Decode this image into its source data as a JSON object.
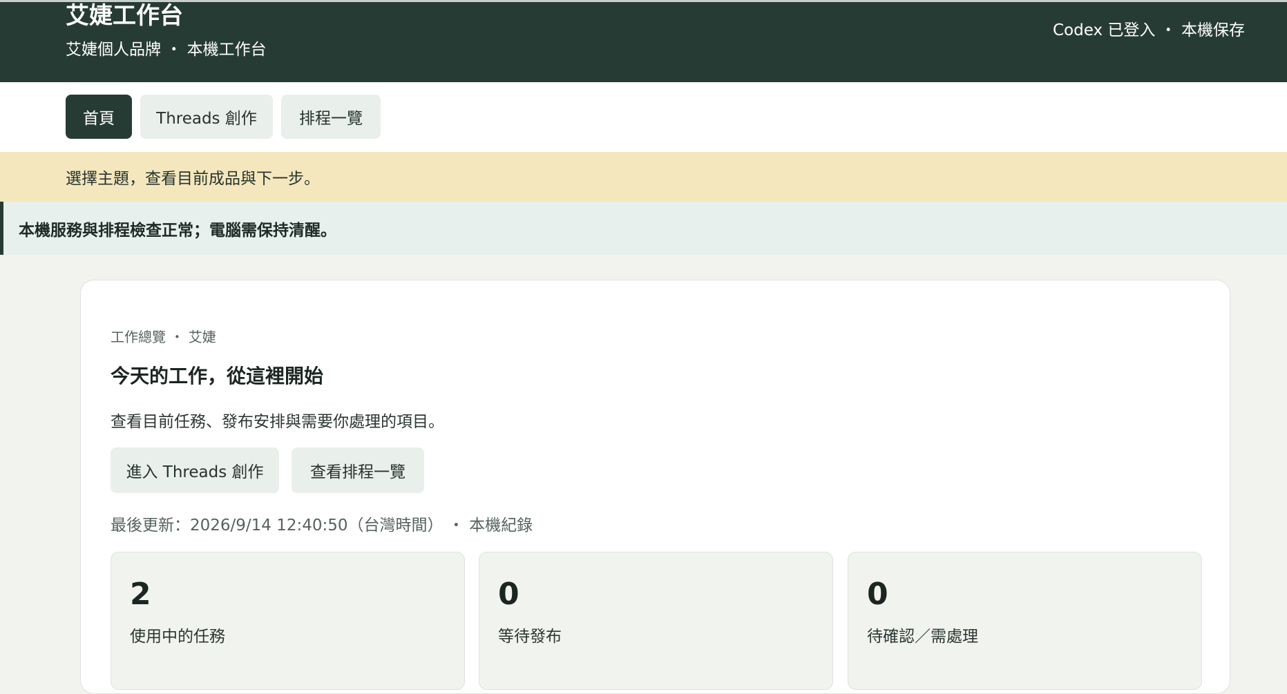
{
  "header": {
    "title": "艾婕工作台",
    "subtitle": "艾婕個人品牌 ・ 本機工作台",
    "session_status": "Codex 已登入 ・ 本機保存"
  },
  "tabs": [
    {
      "label": "首頁",
      "active": true
    },
    {
      "label": "Threads 創作",
      "active": false
    },
    {
      "label": "排程一覽",
      "active": false
    }
  ],
  "hint_banner": "選擇主題，查看目前成品與下一步。",
  "status_banner": "本機服務與排程檢查正常；電腦需保持清醒。",
  "overview": {
    "eyebrow": "工作總覽 ・ 艾婕",
    "title": "今天的工作，從這裡開始",
    "description": "查看目前任務、發布安排與需要你處理的項目。",
    "buttons": [
      {
        "label": "進入 Threads 創作"
      },
      {
        "label": "查看排程一覽"
      }
    ],
    "last_updated": "最後更新：2026/9/14 12:40:50（台灣時間） ・ 本機紀錄",
    "stats": [
      {
        "value": "2",
        "label": "使用中的任務"
      },
      {
        "value": "0",
        "label": "等待發布"
      },
      {
        "value": "0",
        "label": "待確認／需處理"
      }
    ]
  },
  "colors": {
    "header_bg": "#273b35",
    "hint_banner_bg": "#f5e7bd",
    "status_banner_bg": "#e7f0ec",
    "page_bg": "#f2f3ee",
    "tab_bg": "#e9efea"
  }
}
